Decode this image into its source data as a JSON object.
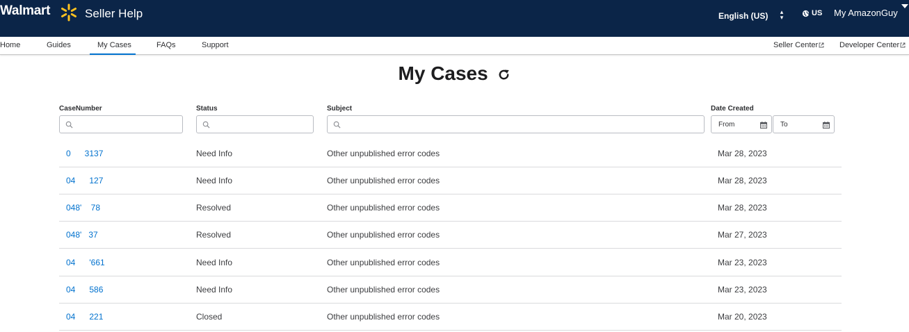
{
  "header": {
    "brand": "Walmart",
    "site_title": "Seller Help",
    "language": "English (US)",
    "region": "US",
    "user": "My AmazonGuy"
  },
  "nav": {
    "items": [
      {
        "label": "Home"
      },
      {
        "label": "Guides"
      },
      {
        "label": "My Cases"
      },
      {
        "label": "FAQs"
      },
      {
        "label": "Support"
      }
    ],
    "external": [
      {
        "label": "Seller Center"
      },
      {
        "label": "Developer Center"
      }
    ]
  },
  "page": {
    "title": "My Cases"
  },
  "filters": {
    "case_number_label": "CaseNumber",
    "status_label": "Status",
    "subject_label": "Subject",
    "date_label": "Date Created",
    "from_placeholder": "From",
    "to_placeholder": "To"
  },
  "cases": [
    {
      "number": "0      3137",
      "status": "Need Info",
      "subject": "Other unpublished error codes",
      "date": "Mar 28, 2023"
    },
    {
      "number": "04      127",
      "status": "Need Info",
      "subject": "Other unpublished error codes",
      "date": "Mar 28, 2023"
    },
    {
      "number": "048'    78",
      "status": "Resolved",
      "subject": "Other unpublished error codes",
      "date": "Mar 28, 2023"
    },
    {
      "number": "048'   37",
      "status": "Resolved",
      "subject": "Other unpublished error codes",
      "date": "Mar 27, 2023"
    },
    {
      "number": "04      '661",
      "status": "Need Info",
      "subject": "Other unpublished error codes",
      "date": "Mar 23, 2023"
    },
    {
      "number": "04      586",
      "status": "Need Info",
      "subject": "Other unpublished error codes",
      "date": "Mar 23, 2023"
    },
    {
      "number": "04      221",
      "status": "Closed",
      "subject": "Other unpublished error codes",
      "date": "Mar 20, 2023"
    }
  ],
  "colors": {
    "header_bg": "#0b2548",
    "accent": "#0071ce",
    "spark": "#ffc220"
  },
  "icons": [
    "spark-icon",
    "updown-arrows-icon",
    "globe-icon",
    "caret-down-icon",
    "external-link-icon",
    "refresh-icon",
    "search-icon",
    "calendar-icon"
  ]
}
